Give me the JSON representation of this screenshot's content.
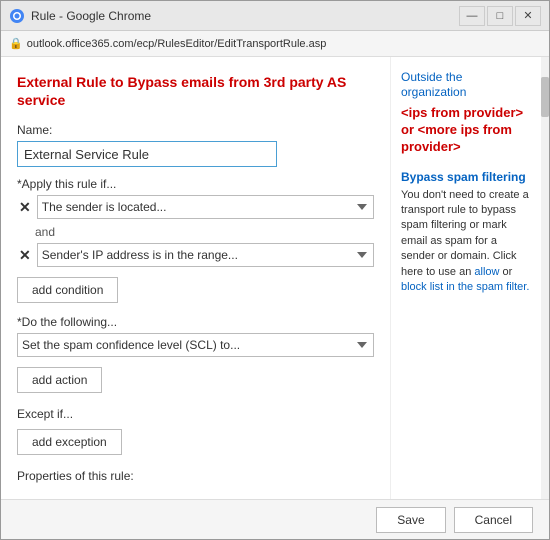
{
  "window": {
    "title": "Rule - Google Chrome",
    "address": "outlook.office365.com/ecp/RulesEditor/EditTransportRule.asp"
  },
  "titleBar": {
    "minimize": "—",
    "maximize": "□",
    "close": "✕"
  },
  "page": {
    "title": "External Rule to Bypass emails from 3rd party AS service",
    "nameLabel": "Name:",
    "nameValue": "External Service Rule",
    "applyRuleLabel": "*Apply this rule if...",
    "condition1": "The sender is located...",
    "andLabel": "and",
    "condition2": "Sender's IP address is in the range...",
    "addConditionLabel": "add condition",
    "doFollowingLabel": "*Do the following...",
    "action1": "Set the spam confidence level (SCL) to...",
    "addActionLabel": "add action",
    "exceptIfLabel": "Except if...",
    "addExceptionLabel": "add exception",
    "propertiesLabel": "Properties of this rule:"
  },
  "sidePanel": {
    "outsideOrgLink": "Outside the organization",
    "ipsText": "<ips from provider> or <more ips from provider>",
    "bypassHeading": "Bypass spam filtering",
    "bypassText": "You don't need to create a transport rule to bypass spam filtering or mark email as spam for a sender or domain. Click here to use an",
    "allowLink": "allow",
    "orText": "or",
    "blockListLink": "block list in",
    "spamFilterText": "the spam filter."
  },
  "footer": {
    "saveLabel": "Save",
    "cancelLabel": "Cancel"
  }
}
